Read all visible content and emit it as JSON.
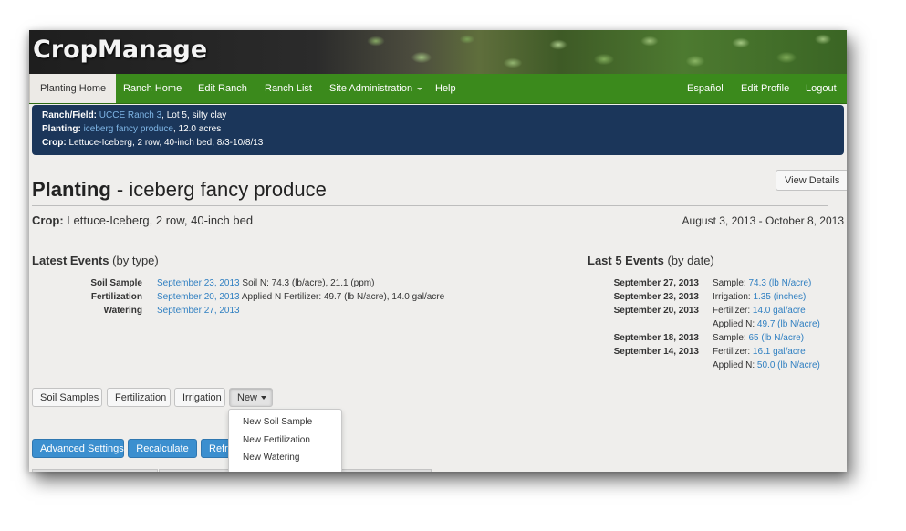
{
  "app": {
    "logo": "CropManage"
  },
  "nav": {
    "left": [
      "Planting Home",
      "Ranch Home",
      "Edit Ranch",
      "Ranch List",
      "Site Administration",
      "Help"
    ],
    "right": [
      "Español",
      "Edit Profile",
      "Logout"
    ]
  },
  "info": {
    "ranch_label": "Ranch/Field:",
    "ranch_link": "UCCE Ranch 3",
    "ranch_rest": ", Lot 5, silty clay",
    "planting_label": "Planting:",
    "planting_link": "iceberg fancy produce",
    "planting_rest": ", 12.0 acres",
    "crop_label": "Crop:",
    "crop_value": "Lettuce-Iceberg, 2 row, 40-inch bed, 8/3-10/8/13"
  },
  "page": {
    "view_details": "View Details",
    "title_bold": "Planting",
    "title_sep": " - ",
    "title_name": "iceberg fancy produce",
    "crop_label": "Crop:",
    "crop_value": "Lettuce-Iceberg, 2 row, 40-inch bed",
    "date_range": "August 3, 2013 - October 8, 2013"
  },
  "latest": {
    "heading": "Latest Events",
    "sub": "(by type)",
    "rows": [
      {
        "label": "Soil Sample",
        "date": "September 23, 2013",
        "detail": "Soil N: 74.3 (lb/acre), 21.1 (ppm)"
      },
      {
        "label": "Fertilization",
        "date": "September 20, 2013",
        "detail": "Applied N Fertilizer: 49.7 (lb N/acre), 14.0 gal/acre"
      },
      {
        "label": "Watering",
        "date": "September 27, 2013",
        "detail": ""
      }
    ]
  },
  "last5": {
    "heading": "Last 5 Events",
    "sub": "(by date)",
    "rows": [
      {
        "date": "September 27, 2013",
        "prefix": "Sample: ",
        "link": "74.3 (lb N/acre)"
      },
      {
        "date": "September 23, 2013",
        "prefix": "Irrigation: ",
        "link": "1.35 (inches)"
      },
      {
        "date": "September 20, 2013",
        "prefix": "Fertilizer: ",
        "link": "14.0 gal/acre"
      },
      {
        "date": "",
        "prefix": "Applied N: ",
        "link": "49.7 (lb N/acre)"
      },
      {
        "date": "September 18, 2013",
        "prefix": "Sample: ",
        "link": "65 (lb N/acre)"
      },
      {
        "date": "September 14, 2013",
        "prefix": "Fertilizer: ",
        "link": "16.1 gal/acre"
      },
      {
        "date": "",
        "prefix": "Applied N: ",
        "link": "50.0 (lb N/acre)"
      }
    ]
  },
  "actions": {
    "soil_samples": "Soil Samples",
    "fertilization": "Fertilization",
    "irrigation": "Irrigation",
    "new": "New",
    "advanced_settings": "Advanced Settings",
    "recalculate": "Recalculate",
    "refresh_partial": "Refr"
  },
  "new_menu": [
    "New Soil Sample",
    "New Fertilization",
    "New Watering"
  ],
  "colors": {
    "nav_green": "#3b8a1c",
    "info_navy": "#1b365a",
    "link_blue": "#2f7fc1",
    "button_blue": "#3b8fcf"
  }
}
